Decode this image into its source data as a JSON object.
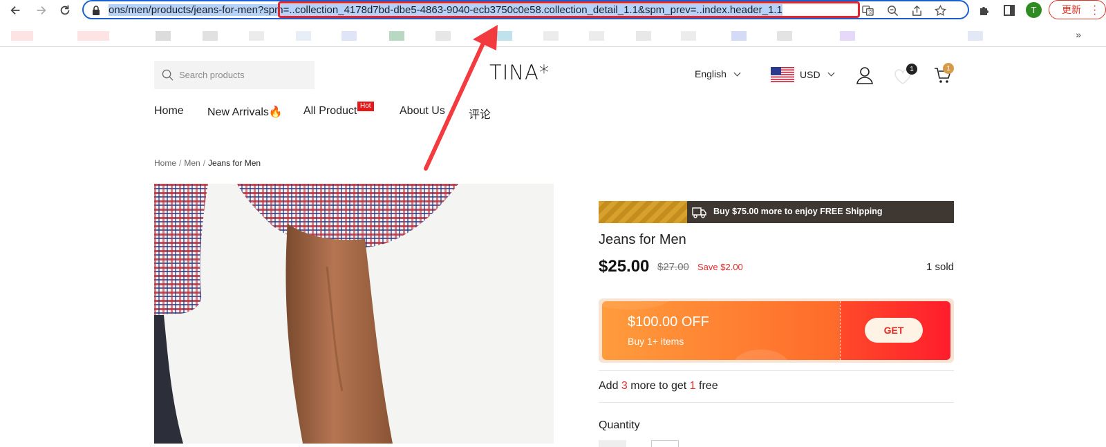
{
  "browser": {
    "url_selected": "ons/men/products/jeans-for-men",
    "url_query": "?spm=..collection_4178d7bd-dbe5-4863-9040-ecb3750c0e58.collection_detail_1.1&spm_prev=..index.header_1.1",
    "profile_initial": "T",
    "update_label": "更新",
    "back_icon": "back-arrow-icon",
    "forward_icon": "forward-arrow-icon",
    "reload_icon": "reload-icon",
    "highlight_color": "#e3262b",
    "selection_color": "#b5d2fb"
  },
  "bookmarks_more": "»",
  "store": {
    "search_placeholder": "Search products",
    "logo": "TINA*",
    "language": "English",
    "currency": "USD",
    "wishlist_count": "1",
    "cart_count": "1",
    "nav": [
      {
        "label": "Home"
      },
      {
        "label": "New Arrivals🔥"
      },
      {
        "label": "All Product"
      },
      {
        "label": "About Us"
      },
      {
        "label": "评论"
      }
    ],
    "hot_tag": "Hot"
  },
  "breadcrumb": {
    "items": [
      "Home",
      "Men"
    ],
    "current": "Jeans for Men",
    "separator": "/"
  },
  "product": {
    "shipping_text": "Buy $75.00 more to enjoy FREE Shipping",
    "title": "Jeans for Men",
    "price": "$25.00",
    "old_price": "$27.00",
    "save": "Save $2.00",
    "sold": "1 sold",
    "coupon_amount": "$100.00 OFF",
    "coupon_condition": "Buy 1+ items",
    "coupon_button": "GET",
    "promo_prefix": "Add",
    "promo_qty": "3",
    "promo_mid": "more to get",
    "promo_free": "1",
    "promo_suffix": "free",
    "quantity_label": "Quantity",
    "accent": "#e22b2b"
  }
}
